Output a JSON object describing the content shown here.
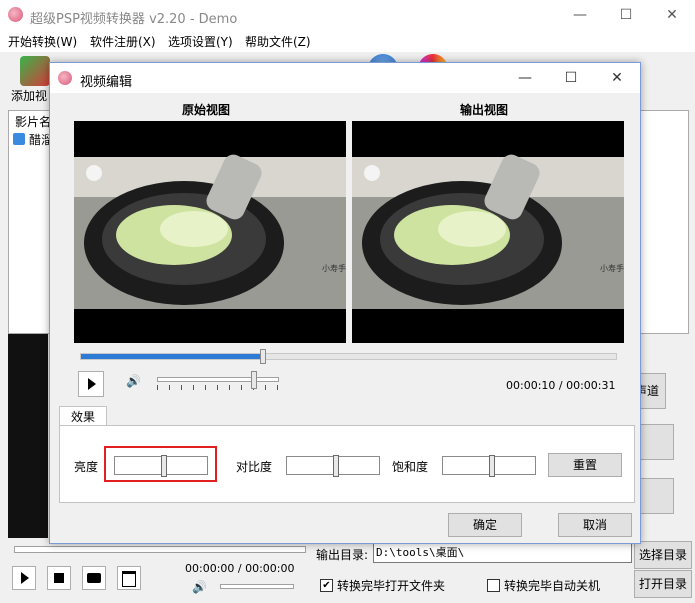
{
  "main_window": {
    "title": "超级PSP视频转换器 v2.20 - Demo",
    "controls": {
      "minimize": "—",
      "maximize": "☐",
      "close": "✕"
    }
  },
  "menu": [
    "开始转换(W)",
    "软件注册(X)",
    "选项设置(Y)",
    "帮助文件(Z)"
  ],
  "toolbar": {
    "add_label": "添加视"
  },
  "file_list": {
    "header": "影片名",
    "item": "醋溜"
  },
  "side_buttons": {
    "channel": "声道"
  },
  "bottom": {
    "time": "00:00:00 / 00:00:00",
    "output_dir_label": "输出目录:",
    "output_dir_value": "D:\\tools\\桌面\\",
    "select_dir_button": "选择目录",
    "open_dir_button": "打开目录",
    "open_folder_checkbox": {
      "label": "转换完毕打开文件夹",
      "checked": true
    },
    "shutdown_checkbox": {
      "label": "转换完毕自动关机",
      "checked": false
    }
  },
  "dialog": {
    "title": "视频编辑",
    "original_view_label": "原始视图",
    "output_view_label": "输出视图",
    "seek_progress": 0.34,
    "volume_level": 0.78,
    "time_display": "00:00:10 / 00:00:31",
    "effects_tab": "效果",
    "brightness_label": "亮度",
    "contrast_label": "对比度",
    "saturation_label": "饱和度",
    "reset_button": "重置",
    "ok_button": "确定",
    "cancel_button": "取消",
    "video_watermark": "小寿手造",
    "highlight_color": "#e02020"
  }
}
